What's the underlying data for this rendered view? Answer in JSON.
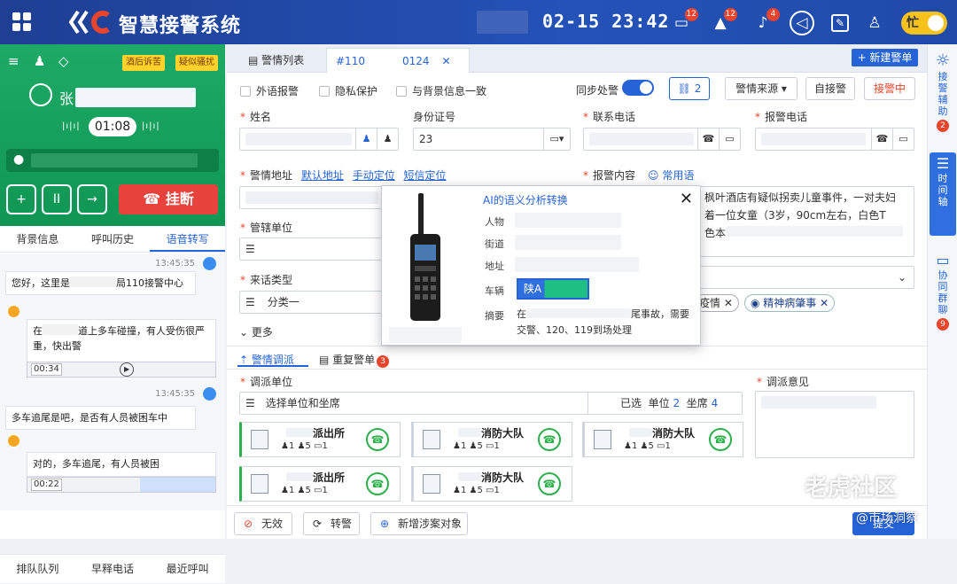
{
  "app": {
    "title": "智慧接警系统",
    "clock": "02-15 23:42",
    "status": "忙"
  },
  "topbar": {
    "msg_badge": "12",
    "alarm_badge": "12",
    "bell_badge": "4"
  },
  "call": {
    "tags": [
      "酒后诉苦",
      "疑似骚扰"
    ],
    "caller_prefix": "张",
    "timer": "01:08",
    "hangup": "挂断"
  },
  "left_tabs": [
    "背景信息",
    "呼叫历史",
    "语音转写"
  ],
  "chat": {
    "t1": "13:45:35",
    "m1a": "您好，这里是",
    "m1b": "局110接警中心",
    "m2a": "在",
    "m2b": "道上多车碰撞，有人受伤很严重，快出警",
    "a1": "00:34",
    "t2": "13:45:35",
    "m3": "多车追尾是吧，是否有人员被困车中",
    "m4": "对的，多车追尾，有人员被困",
    "a2": "00:22"
  },
  "left_footer": [
    "排队队列",
    "早释电话",
    "最近呼叫"
  ],
  "tabs": {
    "list": "警情列表",
    "current_a": "#110",
    "current_b": "0124",
    "new_btn": "+ 新建警单"
  },
  "options": {
    "c1": "外语报警",
    "c2": "隐私保护",
    "c3": "与背景信息一致",
    "sync": "同步处警",
    "link_count": "2",
    "source": "警情来源",
    "self": "自接警",
    "receiving": "接警中"
  },
  "form": {
    "name": "姓名",
    "id_no": "身份证号",
    "id_value": "23",
    "contact": "联系电话",
    "report_phone": "报警电话",
    "address": "警情地址",
    "addr_links": [
      "默认地址",
      "手动定位",
      "短信定位"
    ],
    "content": "报警内容",
    "common": "常用语",
    "content_text_1": "枫叶酒店有疑似拐卖儿童事件，一对夫妇",
    "content_text_2": "着一位女童（3岁，90cm左右，白色T",
    "content_text_3": "色本",
    "unit": "管辖单位",
    "call_type": "来话类型",
    "call_type_value": "分类一",
    "more": "更多",
    "chips": [
      "疫情",
      "精神病肇事"
    ]
  },
  "dispatch": {
    "tab1": "警情调派",
    "tab2": "重复警单",
    "dup_badge": "3",
    "unit_label": "调派单位",
    "opinion": "调派意见",
    "select_ph": "选择单位和坐席",
    "selected": "已选",
    "unit_word": "单位",
    "unit_n": "2",
    "seat_word": "坐席",
    "seat_n": "4",
    "units": [
      {
        "name": "派出所",
        "a": "1",
        "b": "5",
        "c": "1"
      },
      {
        "name": "消防大队",
        "a": "1",
        "b": "5",
        "c": "1"
      },
      {
        "name": "消防大队",
        "a": "1",
        "b": "5",
        "c": "1"
      },
      {
        "name": "派出所",
        "a": "1",
        "b": "5",
        "c": "1"
      },
      {
        "name": "消防大队",
        "a": "1",
        "b": "5",
        "c": "1"
      }
    ]
  },
  "bottom": {
    "invalid": "无效",
    "transfer": "转警",
    "add": "新增涉案对象",
    "submit": "提交"
  },
  "right": {
    "assist": "接警辅助",
    "assist_n": "2",
    "timeline": "时间轴",
    "collab": "协同群聊",
    "collab_n": "9"
  },
  "popup": {
    "title": "AI的语义分析转换",
    "f_person": "人物",
    "f_street": "街道",
    "f_addr": "地址",
    "f_car": "车辆",
    "f_sum": "摘要",
    "plate": "陕A",
    "sum_a": "在",
    "sum_b": "尾事故，需要交警、120、119到场处理"
  },
  "watermark": "老虎社区",
  "watermark2": "@市场洞察"
}
